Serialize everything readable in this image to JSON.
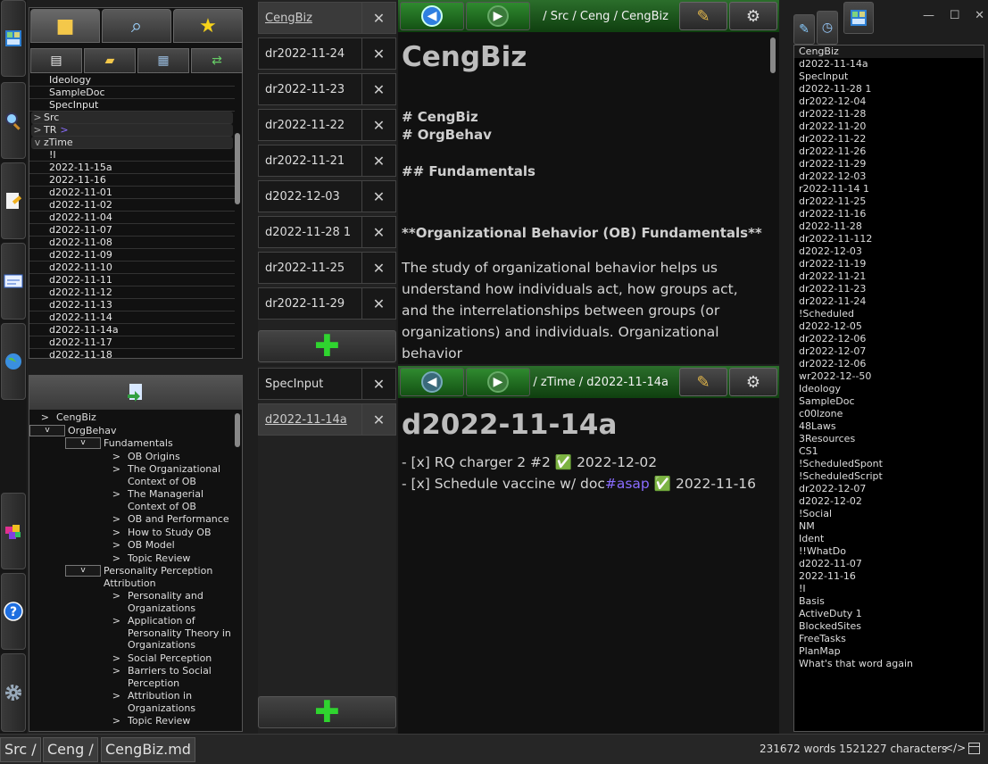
{
  "rail": {
    "icons": [
      "app-logo-icon",
      "search-icon",
      "edit-note-icon",
      "card-icon",
      "globe-icon",
      "cube-icon",
      "help-icon",
      "gear-icon"
    ]
  },
  "file_tree": {
    "items": [
      {
        "label": "Ideology",
        "kind": "file"
      },
      {
        "label": "SampleDoc",
        "kind": "file"
      },
      {
        "label": "SpecInput",
        "kind": "file"
      },
      {
        "label": "Src",
        "kind": "folder",
        "caret": ">"
      },
      {
        "label": "TR",
        "kind": "folder",
        "caret": ">",
        "suffix": ">"
      },
      {
        "label": "zTime",
        "kind": "folder",
        "caret": "v"
      },
      {
        "label": "!I",
        "kind": "file"
      },
      {
        "label": "2022-11-15a",
        "kind": "file"
      },
      {
        "label": "2022-11-16",
        "kind": "file"
      },
      {
        "label": "d2022-11-01",
        "kind": "file"
      },
      {
        "label": "d2022-11-02",
        "kind": "file"
      },
      {
        "label": "d2022-11-04",
        "kind": "file"
      },
      {
        "label": "d2022-11-07",
        "kind": "file"
      },
      {
        "label": "d2022-11-08",
        "kind": "file"
      },
      {
        "label": "d2022-11-09",
        "kind": "file"
      },
      {
        "label": "d2022-11-10",
        "kind": "file"
      },
      {
        "label": "d2022-11-11",
        "kind": "file"
      },
      {
        "label": "d2022-11-12",
        "kind": "file"
      },
      {
        "label": "d2022-11-13",
        "kind": "file"
      },
      {
        "label": "d2022-11-14",
        "kind": "file"
      },
      {
        "label": "d2022-11-14a",
        "kind": "file"
      },
      {
        "label": "d2022-11-17",
        "kind": "file"
      },
      {
        "label": "d2022-11-18",
        "kind": "file"
      }
    ]
  },
  "outline": {
    "items": [
      {
        "label": "CengBiz",
        "level": 0,
        "caret": ">"
      },
      {
        "label": "OrgBehav",
        "level": 0,
        "caret": "v"
      },
      {
        "label": "Fundamentals",
        "level": 1,
        "caret": "v"
      },
      {
        "label": "OB Origins",
        "level": 2,
        "caret": ">"
      },
      {
        "label": "The Organizational Context of OB",
        "level": 2,
        "caret": ">"
      },
      {
        "label": "The Managerial Context of OB",
        "level": 2,
        "caret": ">"
      },
      {
        "label": "OB and Performance",
        "level": 2,
        "caret": ">"
      },
      {
        "label": "How to Study OB",
        "level": 2,
        "caret": ">"
      },
      {
        "label": "OB Model",
        "level": 2,
        "caret": ">"
      },
      {
        "label": "Topic Review",
        "level": 2,
        "caret": ">"
      },
      {
        "label": "Personality Perception Attribution",
        "level": 1,
        "caret": "v"
      },
      {
        "label": "Personality and Organizations",
        "level": 2,
        "caret": ">"
      },
      {
        "label": "Application of Personality Theory in Organizations",
        "level": 2,
        "caret": ">"
      },
      {
        "label": "Social Perception",
        "level": 2,
        "caret": ">"
      },
      {
        "label": "Barriers to Social Perception",
        "level": 2,
        "caret": ">"
      },
      {
        "label": "Attribution in Organizations",
        "level": 2,
        "caret": ">"
      },
      {
        "label": "Topic Review",
        "level": 2,
        "caret": ">"
      }
    ]
  },
  "top_tabs": [
    "CengBiz",
    "dr2022-11-24",
    "dr2022-11-23",
    "dr2022-11-22",
    "dr2022-11-21",
    "d2022-12-03",
    "d2022-11-28 1",
    "dr2022-11-25",
    "dr2022-11-29"
  ],
  "bottom_tabs": [
    "SpecInput",
    "d2022-11-14a"
  ],
  "close_glyph": "✕",
  "add_glyph": "✚",
  "top_pane": {
    "breadcrumb": "/ Src / Ceng / CengBiz",
    "title": "CengBiz",
    "h_cengbiz": "# CengBiz",
    "h_orgbehav": "# OrgBehav",
    "h_fund": "## Fundamentals",
    "bold_line": "**Organizational Behavior (OB) Fundamentals**",
    "paragraph": "The study of organizational behavior helps us understand how individuals act, how groups act, and the interrelationships between groups (or organizations) and individuals. Organizational behavior"
  },
  "bottom_pane": {
    "breadcrumb": "/ zTime / d2022-11-14a",
    "title": "d2022-11-14a",
    "task1": {
      "prefix": "- [x] RQ charger 2 #2",
      "date": "2022-12-02"
    },
    "task2": {
      "prefix": "- [x] Schedule vaccine w/ doc",
      "tag": "#asap",
      "date": "2022-11-16"
    },
    "check_glyph": "✅"
  },
  "window_controls": {
    "minimize": "—",
    "maximize": "☐",
    "close": "✕"
  },
  "right_list": [
    "CengBiz",
    "d2022-11-14a",
    "SpecInput",
    "d2022-11-28 1",
    "dr2022-12-04",
    "dr2022-11-28",
    "dr2022-11-20",
    "dr2022-11-22",
    "dr2022-11-26",
    "dr2022-11-29",
    "dr2022-12-03",
    "r2022-11-14 1",
    "dr2022-11-25",
    "dr2022-11-16",
    "d2022-11-28",
    "dr2022-11-112",
    "d2022-12-03",
    "dr2022-11-19",
    "dr2022-11-21",
    "dr2022-11-23",
    "dr2022-11-24",
    "!Scheduled",
    "d2022-12-05",
    "dr2022-12-06",
    "dr2022-12-07",
    "dr2022-12-06",
    "wr2022-12--50",
    "Ideology",
    "SampleDoc",
    "c00lzone",
    "48Laws",
    "3Resources",
    "CS1",
    "!ScheduledSpont",
    "!ScheduledScript",
    "dr2022-12-07",
    "d2022-12-02",
    "!Social",
    "NM",
    "Ident",
    "!!WhatDo",
    "d2022-11-07",
    "2022-11-16",
    "!I",
    "Basis",
    "ActiveDuty 1",
    "BlockedSites",
    "FreeTasks",
    "PlanMap",
    "What's that word again"
  ],
  "status": {
    "crumb1": "Src /",
    "crumb2": "Ceng /",
    "crumb3": "CengBiz.md",
    "stats": "231672 words 1521227 characters",
    "code_icon": "</>"
  },
  "colors": {
    "accent_green": "#1e7a1e",
    "tag_purple": "#8a6cff",
    "checkmark": "#2ecc40"
  }
}
